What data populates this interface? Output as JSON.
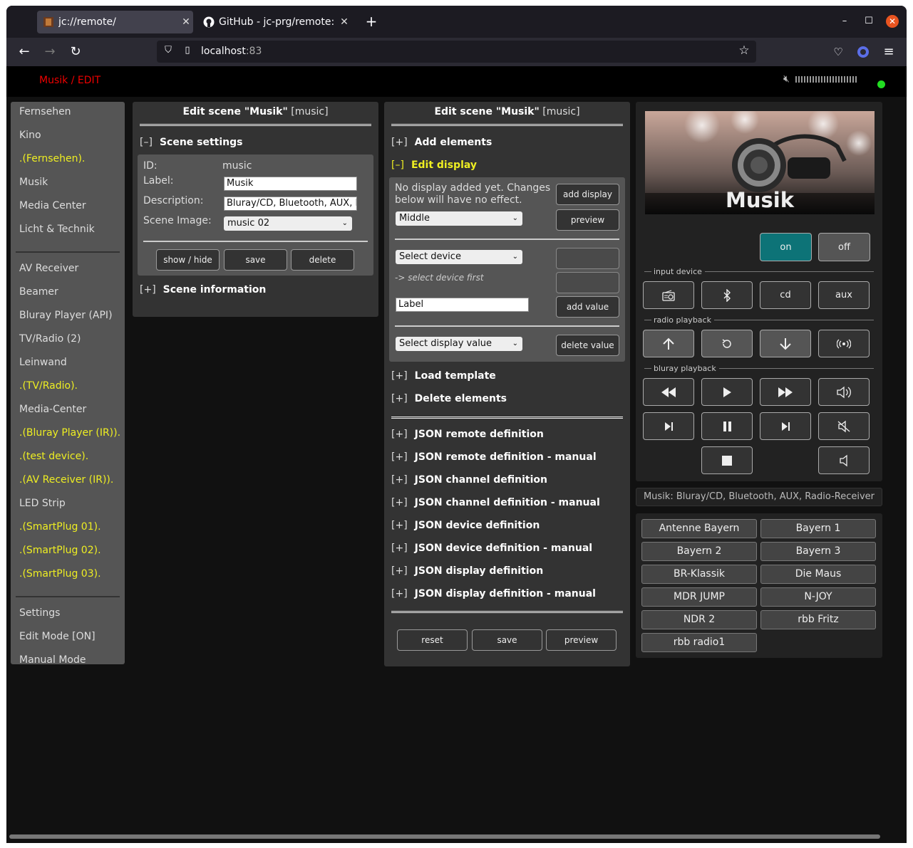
{
  "browser": {
    "tabs": [
      {
        "title": "jc://remote/"
      },
      {
        "title": "GitHub - jc-prg/remote: jc"
      }
    ],
    "url_host": "localhost",
    "url_port": ":83"
  },
  "app": {
    "title": "Musik / EDIT"
  },
  "sidebar": {
    "group1": [
      {
        "label": "Fernsehen",
        "hidden": false
      },
      {
        "label": "Kino",
        "hidden": false
      },
      {
        "label": ".(Fernsehen).",
        "hidden": true
      },
      {
        "label": "Musik",
        "hidden": false
      },
      {
        "label": "Media Center",
        "hidden": false
      },
      {
        "label": "Licht & Technik",
        "hidden": false
      }
    ],
    "group2": [
      {
        "label": "AV Receiver",
        "hidden": false
      },
      {
        "label": "Beamer",
        "hidden": false
      },
      {
        "label": "Bluray Player (API)",
        "hidden": false
      },
      {
        "label": "TV/Radio (2)",
        "hidden": false
      },
      {
        "label": "Leinwand",
        "hidden": false
      },
      {
        "label": ".(TV/Radio).",
        "hidden": true
      },
      {
        "label": "Media-Center",
        "hidden": false
      },
      {
        "label": ".(Bluray Player (IR)).",
        "hidden": true
      },
      {
        "label": ".(test device).",
        "hidden": true
      },
      {
        "label": ".(AV Receiver (IR)).",
        "hidden": true
      },
      {
        "label": "LED Strip",
        "hidden": false
      },
      {
        "label": ".(SmartPlug 01).",
        "hidden": true
      },
      {
        "label": ".(SmartPlug 02).",
        "hidden": true
      },
      {
        "label": ".(SmartPlug 03).",
        "hidden": true
      }
    ],
    "group3": [
      {
        "label": "Settings",
        "hidden": false
      },
      {
        "label": "Edit Mode [ON]",
        "hidden": false
      },
      {
        "label": "Manual Mode",
        "hidden": false
      }
    ]
  },
  "panel1": {
    "title_prefix": "Edit scene \"Musik\"",
    "title_id": "[music]",
    "settings_toggle": "[–]",
    "settings_title": "Scene settings",
    "id_label": "ID:",
    "id_value": "music",
    "label_label": "Label:",
    "label_value": "Musik",
    "desc_label": "Description:",
    "desc_value": "Bluray/CD, Bluetooth, AUX, Radio-Receiver",
    "image_label": "Scene Image:",
    "image_value": "music 02",
    "btn_showhide": "show / hide",
    "btn_save": "save",
    "btn_delete": "delete",
    "info_toggle": "[+]",
    "info_title": "Scene information"
  },
  "panel2": {
    "title_prefix": "Edit scene \"Musik\"",
    "title_id": "[music]",
    "add_toggle": "[+]",
    "add_title": "Add elements",
    "display_toggle": "[–]",
    "display_title": "Edit display",
    "no_display_text": "No display added yet. Changes below will have no effect.",
    "btn_add_display": "add display",
    "position_value": "Middle",
    "btn_preview": "preview",
    "device_select": "Select device",
    "select_hint": "-> select device first",
    "label_input": "Label",
    "btn_add_value": "add value",
    "display_value_select": "Select display value",
    "btn_delete_value": "delete value",
    "sections": [
      {
        "toggle": "[+]",
        "title": "Load template"
      },
      {
        "toggle": "[+]",
        "title": "Delete elements"
      }
    ],
    "json_sections": [
      {
        "toggle": "[+]",
        "title": "JSON remote definition"
      },
      {
        "toggle": "[+]",
        "title": "JSON remote definition - manual"
      },
      {
        "toggle": "[+]",
        "title": "JSON channel definition"
      },
      {
        "toggle": "[+]",
        "title": "JSON channel definition - manual"
      },
      {
        "toggle": "[+]",
        "title": "JSON device definition"
      },
      {
        "toggle": "[+]",
        "title": "JSON device definition - manual"
      },
      {
        "toggle": "[+]",
        "title": "JSON display definition"
      },
      {
        "toggle": "[+]",
        "title": "JSON display definition - manual"
      }
    ],
    "btn_reset": "reset",
    "btn_save": "save",
    "btn_preview2": "preview"
  },
  "remote": {
    "scene_title": "Musik",
    "btn_on": "on",
    "btn_off": "off",
    "group_input": "input device",
    "group_radio": "radio playback",
    "group_bluray": "bluray playback",
    "btn_cd": "cd",
    "btn_aux": "aux",
    "description": "Musik: Bluray/CD, Bluetooth, AUX, Radio-Receiver",
    "channels": [
      "Antenne Bayern",
      "Bayern 1",
      "Bayern 2",
      "Bayern 3",
      "BR-Klassik",
      "Die Maus",
      "MDR JUMP",
      "N-JOY",
      "NDR 2",
      "rbb Fritz",
      "rbb radio1"
    ],
    "icons": {
      "radio": "radio-icon",
      "bluetooth": "bluetooth-icon",
      "up": "arrow-up-icon",
      "reload": "reload-icon",
      "down": "arrow-down-icon",
      "broadcast": "broadcast-icon",
      "rewind": "rewind-icon",
      "play": "play-icon",
      "fastforward": "fast-forward-icon",
      "volup": "volume-up-icon",
      "prev": "skip-back-icon",
      "pause": "pause-icon",
      "next": "skip-forward-icon",
      "mute": "mute-icon",
      "stop": "stop-icon",
      "voldown": "volume-down-icon"
    },
    "colors": {
      "on_button": "#0d7377",
      "accent_hidden": "#eeee22",
      "title_red": "#ee0000",
      "status_led": "#22dd22"
    }
  }
}
